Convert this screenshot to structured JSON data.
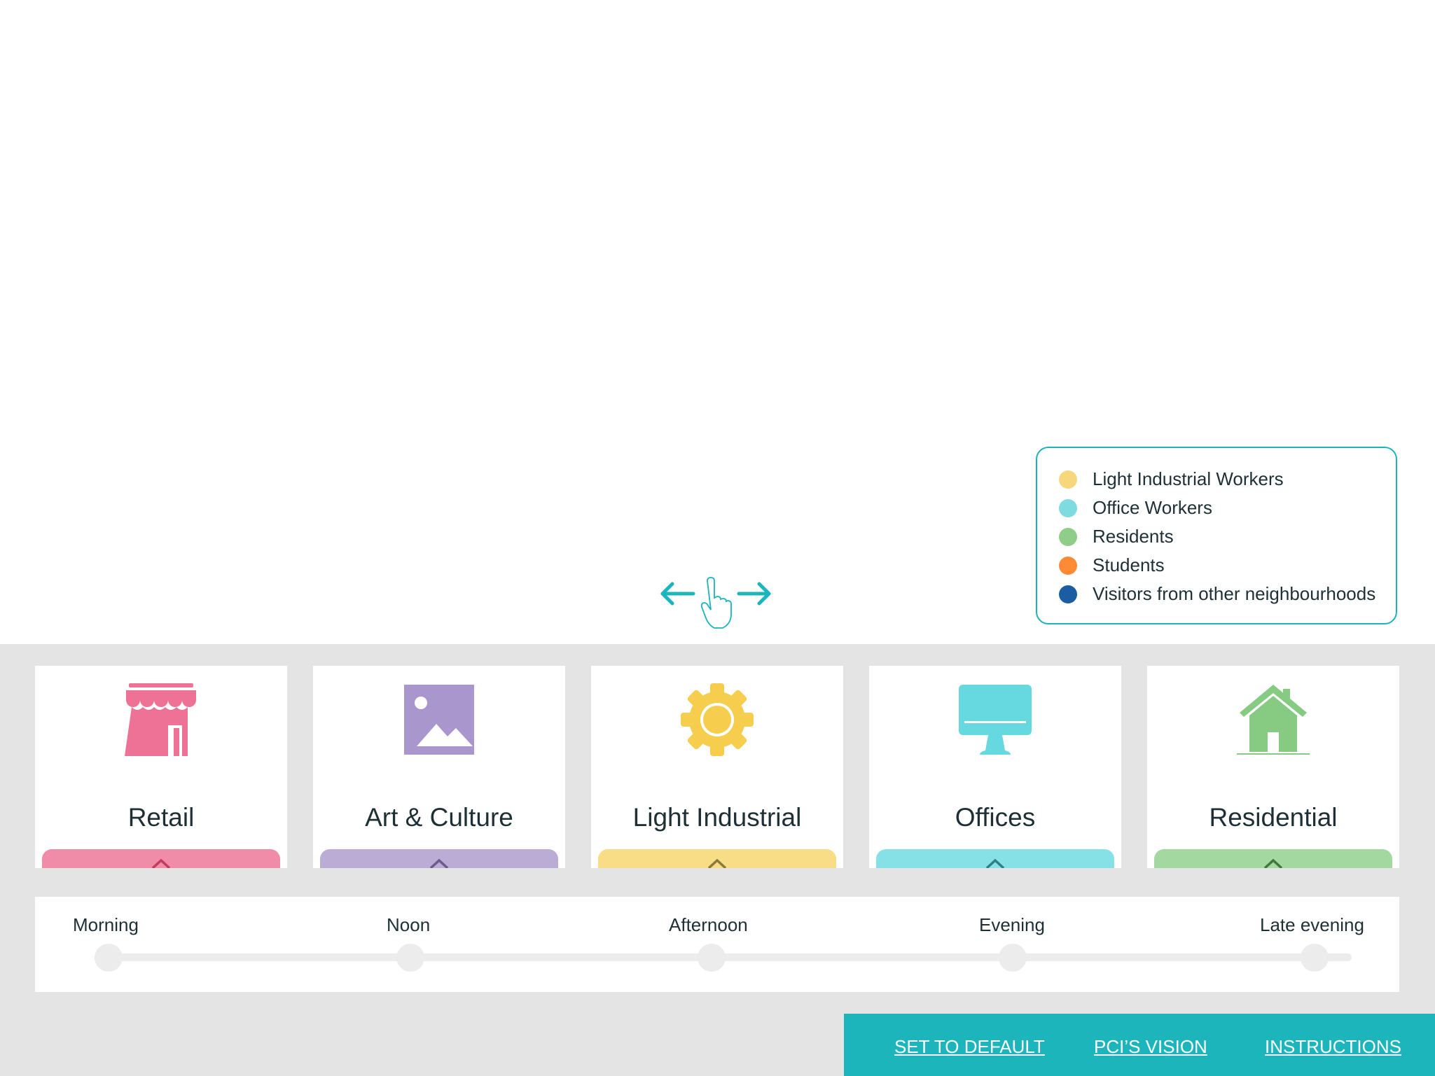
{
  "legend": {
    "items": [
      {
        "label": "Light Industrial Workers",
        "color": "#f7d77b"
      },
      {
        "label": "Office Workers",
        "color": "#7fdbe2"
      },
      {
        "label": "Residents",
        "color": "#8fcd88"
      },
      {
        "label": "Students",
        "color": "#fd8b35"
      },
      {
        "label": "Visitors from other neighbourhoods",
        "color": "#1b5da3"
      }
    ]
  },
  "swipe_hint": {
    "icon": "swipe-hand-icon",
    "color": "#1bb5bb"
  },
  "categories": [
    {
      "label": "Retail",
      "icon": "store-icon",
      "color": "#ee7296",
      "tab_color": "#f08ca8",
      "chevron_color": "#c23c5c"
    },
    {
      "label": "Art & Culture",
      "icon": "image-icon",
      "color": "#a996cd",
      "tab_color": "#bbacd6",
      "chevron_color": "#6b5a8c"
    },
    {
      "label": "Light Industrial",
      "icon": "gear-icon",
      "color": "#f6cd4c",
      "tab_color": "#f9dd86",
      "chevron_color": "#8c7a3a"
    },
    {
      "label": "Offices",
      "icon": "monitor-icon",
      "color": "#66d8e0",
      "tab_color": "#85e1e6",
      "chevron_color": "#2f7f85"
    },
    {
      "label": "Residential",
      "icon": "house-icon",
      "color": "#87cb83",
      "tab_color": "#a3d8a0",
      "chevron_color": "#3f7a3c"
    }
  ],
  "timeline": {
    "stops": [
      "Morning",
      "Noon",
      "Afternoon",
      "Evening",
      "Late evening"
    ]
  },
  "footer": {
    "set_default": "SET TO DEFAULT",
    "vision": "PCI’S VISION",
    "instructions": "INSTRUCTIONS"
  }
}
